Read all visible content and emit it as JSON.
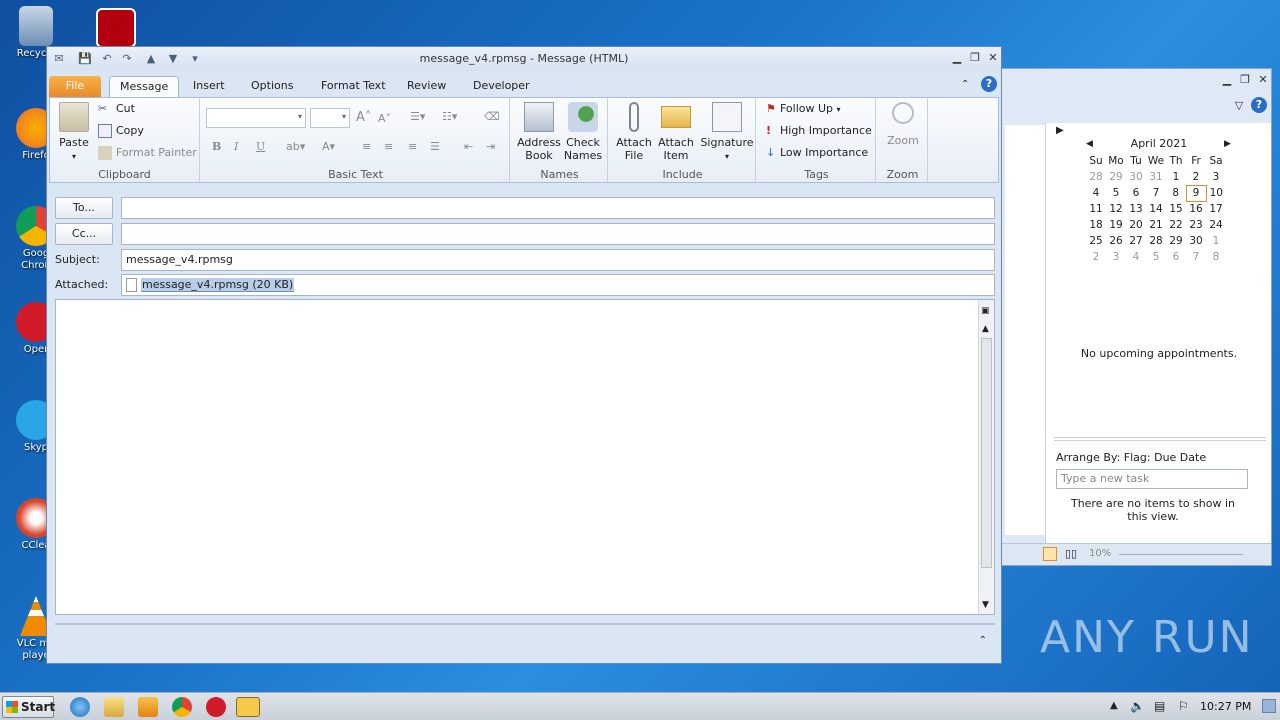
{
  "desktop": {
    "icons": [
      {
        "label": "Recycle",
        "color": "#6d8fb5"
      },
      {
        "label": "Firefo",
        "color": "#e8692b"
      },
      {
        "label": "Goog Chron",
        "color": "#3aa757"
      },
      {
        "label": "Oper",
        "color": "#d11a2a"
      },
      {
        "label": "Skyp",
        "color": "#2aa6e8"
      },
      {
        "label": "CClea",
        "color": "#d9452c"
      },
      {
        "label": "VLC me playe",
        "color": "#f08a00"
      }
    ],
    "watermark": "ANY RUN"
  },
  "window": {
    "title": "message_v4.rpmsg - Message (HTML)",
    "tabs": [
      "File",
      "Message",
      "Insert",
      "Options",
      "Format Text",
      "Review",
      "Developer"
    ]
  },
  "ribbon": {
    "clipboard": {
      "paste": "Paste",
      "cut": "Cut",
      "copy": "Copy",
      "format_painter": "Format Painter",
      "label": "Clipboard"
    },
    "basic_text": {
      "label": "Basic Text"
    },
    "names": {
      "address_book": "Address Book",
      "check_names": "Check Names",
      "label": "Names"
    },
    "include": {
      "attach_file": "Attach File",
      "attach_item": "Attach Item",
      "signature": "Signature",
      "label": "Include"
    },
    "tags": {
      "follow_up": "Follow Up",
      "high_importance": "High Importance",
      "low_importance": "Low Importance",
      "label": "Tags"
    },
    "zoom": {
      "zoom": "Zoom",
      "label": "Zoom"
    }
  },
  "fields": {
    "to_button": "To...",
    "cc_button": "Cc...",
    "subject_label": "Subject:",
    "subject_value": "message_v4.rpmsg",
    "attached_label": "Attached:",
    "attachment": "message_v4.rpmsg (20 KB)"
  },
  "todo": {
    "month": "April 2021",
    "weekdays": [
      "Su",
      "Mo",
      "Tu",
      "We",
      "Th",
      "Fr",
      "Sa"
    ],
    "weeks": [
      [
        "28",
        "29",
        "30",
        "31",
        "1",
        "2",
        "3"
      ],
      [
        "4",
        "5",
        "6",
        "7",
        "8",
        "9",
        "10"
      ],
      [
        "11",
        "12",
        "13",
        "14",
        "15",
        "16",
        "17"
      ],
      [
        "18",
        "19",
        "20",
        "21",
        "22",
        "23",
        "24"
      ],
      [
        "25",
        "26",
        "27",
        "28",
        "29",
        "30",
        "1"
      ],
      [
        "2",
        "3",
        "4",
        "5",
        "6",
        "7",
        "8"
      ]
    ],
    "today": "9",
    "no_appointments": "No upcoming appointments.",
    "arrange_by": "Arrange By: Flag: Due Date",
    "new_task_placeholder": "Type a new task",
    "no_items": "There are no items to show in this view.",
    "zoom_level": "10%"
  },
  "taskbar": {
    "start": "Start",
    "time": "10:27 PM"
  }
}
